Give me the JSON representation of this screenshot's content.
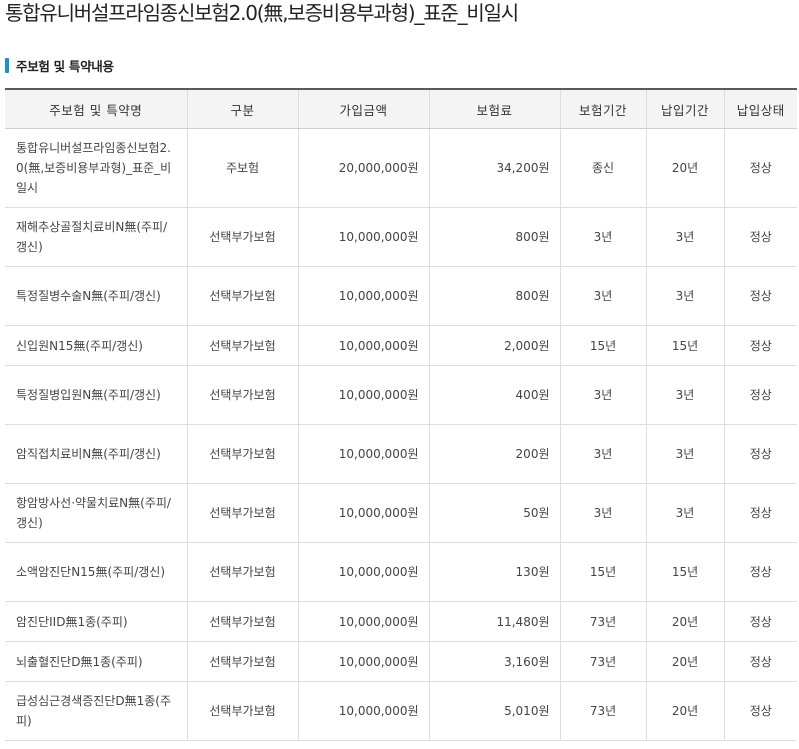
{
  "page_title": "통합유니버설프라임종신보험2.0(無,보증비용부과형)_표준_비일시",
  "section_title": "주보험 및 특약내용",
  "table": {
    "headers": [
      "주보험 및 특약명",
      "구분",
      "가입금액",
      "보험료",
      "보험기간",
      "납입기간",
      "납입상태"
    ],
    "rows": [
      {
        "name": "통합유니버설프라임종신보험2.0(無,보증비용부과형)_표준_비일시",
        "type": "주보험",
        "amount": "20,000,000원",
        "premium": "34,200원",
        "period": "종신",
        "payment_period": "20년",
        "status": "정상"
      },
      {
        "name": "재해추상골절치료비N無(주피/갱신)",
        "type": "선택부가보험",
        "amount": "10,000,000원",
        "premium": "800원",
        "period": "3년",
        "payment_period": "3년",
        "status": "정상"
      },
      {
        "name": "특정질병수술N無(주피/갱신)",
        "type": "선택부가보험",
        "amount": "10,000,000원",
        "premium": "800원",
        "period": "3년",
        "payment_period": "3년",
        "status": "정상"
      },
      {
        "name": "신입원N15無(주피/갱신)",
        "type": "선택부가보험",
        "amount": "10,000,000원",
        "premium": "2,000원",
        "period": "15년",
        "payment_period": "15년",
        "status": "정상"
      },
      {
        "name": "특정질병입원N無(주피/갱신)",
        "type": "선택부가보험",
        "amount": "10,000,000원",
        "premium": "400원",
        "period": "3년",
        "payment_period": "3년",
        "status": "정상"
      },
      {
        "name": "암직접치료비N無(주피/갱신)",
        "type": "선택부가보험",
        "amount": "10,000,000원",
        "premium": "200원",
        "period": "3년",
        "payment_period": "3년",
        "status": "정상"
      },
      {
        "name": "항암방사선·약물치료N無(주피/갱신)",
        "type": "선택부가보험",
        "amount": "10,000,000원",
        "premium": "50원",
        "period": "3년",
        "payment_period": "3년",
        "status": "정상"
      },
      {
        "name": "소액암진단N15無(주피/갱신)",
        "type": "선택부가보험",
        "amount": "10,000,000원",
        "premium": "130원",
        "period": "15년",
        "payment_period": "15년",
        "status": "정상"
      },
      {
        "name": "암진단IID無1종(주피)",
        "type": "선택부가보험",
        "amount": "10,000,000원",
        "premium": "11,480원",
        "period": "73년",
        "payment_period": "20년",
        "status": "정상"
      },
      {
        "name": "뇌출혈진단D無1종(주피)",
        "type": "선택부가보험",
        "amount": "10,000,000원",
        "premium": "3,160원",
        "period": "73년",
        "payment_period": "20년",
        "status": "정상"
      },
      {
        "name": "급성심근경색증진단D無1종(주피)",
        "type": "선택부가보험",
        "amount": "10,000,000원",
        "premium": "5,010원",
        "period": "73년",
        "payment_period": "20년",
        "status": "정상"
      }
    ]
  },
  "colors": {
    "accent_bar": "#1a8fd0",
    "header_bg": "#f4f4f4",
    "table_top_border": "#5a5a5a"
  }
}
